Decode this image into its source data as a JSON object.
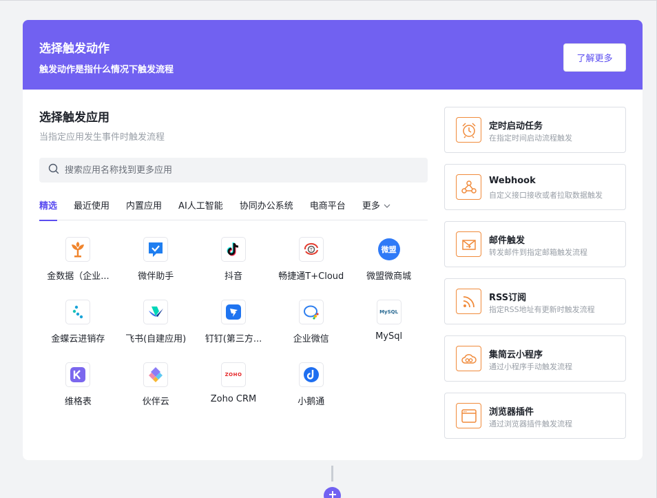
{
  "header": {
    "title": "选择触发动作",
    "subtitle": "触发动作是指什么情况下触发流程",
    "learn_more": "了解更多"
  },
  "apps_section": {
    "title": "选择触发应用",
    "subtitle": "当指定应用发生事件时触发流程",
    "search_placeholder": "搜索应用名称找到更多应用",
    "tabs": [
      "精选",
      "最近使用",
      "内置应用",
      "AI人工智能",
      "协同办公系统",
      "电商平台"
    ],
    "more_label": "更多",
    "apps": [
      {
        "name": "金数据（企业...",
        "icon": "jinshuju-icon"
      },
      {
        "name": "微伴助手",
        "icon": "weiban-icon"
      },
      {
        "name": "抖音",
        "icon": "douyin-icon"
      },
      {
        "name": "畅捷通T+Cloud",
        "icon": "chanjet-icon"
      },
      {
        "name": "微盟微商城",
        "icon": "weimob-icon",
        "badge": "微盟"
      },
      {
        "name": "金蝶云进销存",
        "icon": "kingdee-icon"
      },
      {
        "name": "飞书(自建应用)",
        "icon": "feishu-icon"
      },
      {
        "name": "钉钉(第三方...",
        "icon": "dingtalk-icon"
      },
      {
        "name": "企业微信",
        "icon": "wecom-icon"
      },
      {
        "name": "MySql",
        "icon": "mysql-icon",
        "badge": "MySQL"
      },
      {
        "name": "维格表",
        "icon": "vika-icon"
      },
      {
        "name": "伙伴云",
        "icon": "huoban-icon"
      },
      {
        "name": "Zoho CRM",
        "icon": "zoho-icon",
        "badge": "ZOHO"
      },
      {
        "name": "小鹅通",
        "icon": "xiaoetong-icon"
      }
    ]
  },
  "triggers": [
    {
      "name": "定时启动任务",
      "desc": "在指定时间启动流程触发",
      "icon": "alarm-clock-icon"
    },
    {
      "name": "Webhook",
      "desc": "自定义接口接收或者拉取数据触发",
      "icon": "webhook-icon"
    },
    {
      "name": "邮件触发",
      "desc": "转发邮件到指定邮箱触发流程",
      "icon": "mail-icon"
    },
    {
      "name": "RSS订阅",
      "desc": "指定RSS地址有更新时触发流程",
      "icon": "rss-icon"
    },
    {
      "name": "集简云小程序",
      "desc": "通过小程序手动触发流程",
      "icon": "cloud-icon"
    },
    {
      "name": "浏览器插件",
      "desc": "通过浏览器插件触发流程",
      "icon": "browser-icon"
    }
  ],
  "colors": {
    "accent": "#7161f1",
    "accent_text": "#5b4df0",
    "trigger_icon": "#f08a3a"
  }
}
